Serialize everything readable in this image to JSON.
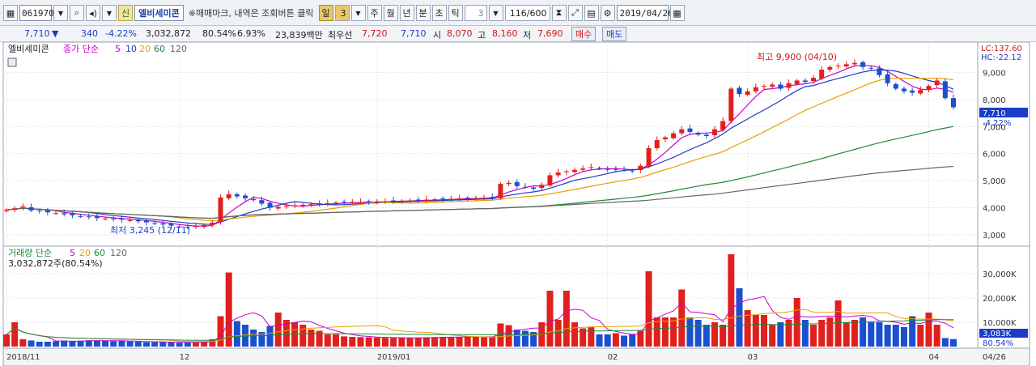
{
  "toolbar": {
    "code": "061970",
    "credit_badge": "신",
    "stock_name": "엘비세미콘",
    "hint": "※매매마크, 내역은 조회버튼 클릭",
    "periods": [
      "일",
      "3",
      "주",
      "월",
      "년",
      "분",
      "초",
      "틱"
    ],
    "active_period": "일",
    "interval": "3",
    "count": "116/600",
    "date": "2019/04/26"
  },
  "quote": {
    "price": "7,710",
    "arrow": "▼",
    "change": "340",
    "change_pct": "-4.22%",
    "volume": "3,032,872",
    "volume_ratio": "80.54%",
    "turnover": "6.93%",
    "amount": "23,839백만",
    "priority_label": "최우선",
    "bid1": "7,720",
    "bid2": "7,710",
    "open_label": "시",
    "open": "8,070",
    "high_label": "고",
    "high": "8,160",
    "low_label": "저",
    "low": "7,690",
    "buy_label": "매수",
    "sell_label": "매도"
  },
  "chart_data": {
    "type": "candlestick",
    "title": "엘비세미콘",
    "legend": {
      "prefix": "종가 단순",
      "periods": [
        "5",
        "10",
        "20",
        "60",
        "120"
      ]
    },
    "lc_label": "LC:137.60",
    "hc_label": "HC:-22.12",
    "y_ticks": [
      "9,000",
      "8,000",
      "7,000",
      "6,000",
      "5,000",
      "4,000",
      "3,000"
    ],
    "ylim": [
      2700,
      10000
    ],
    "current_price_label": "7,710",
    "current_pct_label": "-4.22%",
    "max_label": "최고 9,900 (04/10)",
    "min_label": "최저 3,245 (12/11)",
    "x_labels": [
      "2018/11",
      "12",
      "2019/01",
      "02",
      "03",
      "04",
      "04/26"
    ],
    "closes": [
      3920,
      3980,
      4050,
      3900,
      3870,
      3830,
      3800,
      3760,
      3720,
      3680,
      3650,
      3620,
      3600,
      3580,
      3560,
      3540,
      3500,
      3460,
      3420,
      3380,
      3340,
      3300,
      3290,
      3320,
      3360,
      3450,
      4380,
      4500,
      4420,
      4350,
      4280,
      4150,
      4000,
      4030,
      4060,
      4090,
      4110,
      4130,
      4150,
      4170,
      4190,
      4200,
      4210,
      4210,
      4220,
      4230,
      4240,
      4250,
      4260,
      4270,
      4280,
      4300,
      4310,
      4320,
      4330,
      4340,
      4350,
      4360,
      4370,
      4380,
      4880,
      4920,
      4800,
      4750,
      4700,
      4850,
      5200,
      5300,
      5350,
      5400,
      5450,
      5500,
      5450,
      5400,
      5420,
      5380,
      5360,
      5550,
      6200,
      6500,
      6600,
      6750,
      6900,
      6800,
      6700,
      6650,
      6900,
      7200,
      8400,
      8200,
      8300,
      8450,
      8500,
      8550,
      8400,
      8600,
      8700,
      8650,
      8800,
      9100,
      9200,
      9250,
      9300,
      9350,
      9200,
      9150,
      8900,
      8600,
      8400,
      8300,
      8250,
      8350,
      8500,
      8700,
      8050,
      7710
    ],
    "ma5_label": "MA5",
    "ma20_label": "MA20",
    "ma60_label": "MA60",
    "ma120_label": "MA120",
    "volume_panel": {
      "legend_prefix": "거래량 단순",
      "legend_periods": [
        "5",
        "20",
        "60",
        "120"
      ],
      "current": "3,032,872주(80.54%)",
      "y_ticks": [
        "30,000K",
        "20,000K",
        "10,000K"
      ],
      "ylim": [
        0,
        38000
      ],
      "current_label": "3,083K",
      "ratio_label": "80.54%",
      "volumes_k": [
        5000,
        10000,
        3000,
        2500,
        2000,
        2000,
        2200,
        2500,
        2300,
        2400,
        2600,
        2500,
        2400,
        2200,
        2300,
        2100,
        2000,
        1800,
        1800,
        1800,
        1700,
        1600,
        1700,
        1800,
        2000,
        3000,
        12500,
        30500,
        10500,
        9000,
        7000,
        6000,
        8500,
        14000,
        11000,
        10000,
        9000,
        7000,
        6500,
        5000,
        5000,
        4200,
        4000,
        3900,
        3800,
        3700,
        3600,
        3500,
        3500,
        3600,
        3700,
        3800,
        3900,
        4000,
        4000,
        4000,
        4100,
        4000,
        3900,
        4000,
        9500,
        8800,
        7000,
        6500,
        6000,
        10000,
        23000,
        11000,
        23000,
        10000,
        7500,
        8000,
        5000,
        5000,
        5500,
        4500,
        5000,
        6500,
        31000,
        12000,
        12000,
        12000,
        23500,
        12000,
        11000,
        9000,
        10000,
        9000,
        38000,
        24000,
        15000,
        13000,
        13000,
        9000,
        10000,
        11000,
        20000,
        11000,
        9000,
        11000,
        12000,
        19000,
        10000,
        11000,
        12000,
        10000,
        10000,
        9000,
        9000,
        8000,
        12500,
        9000,
        14000,
        9000,
        3500,
        3083
      ]
    }
  }
}
